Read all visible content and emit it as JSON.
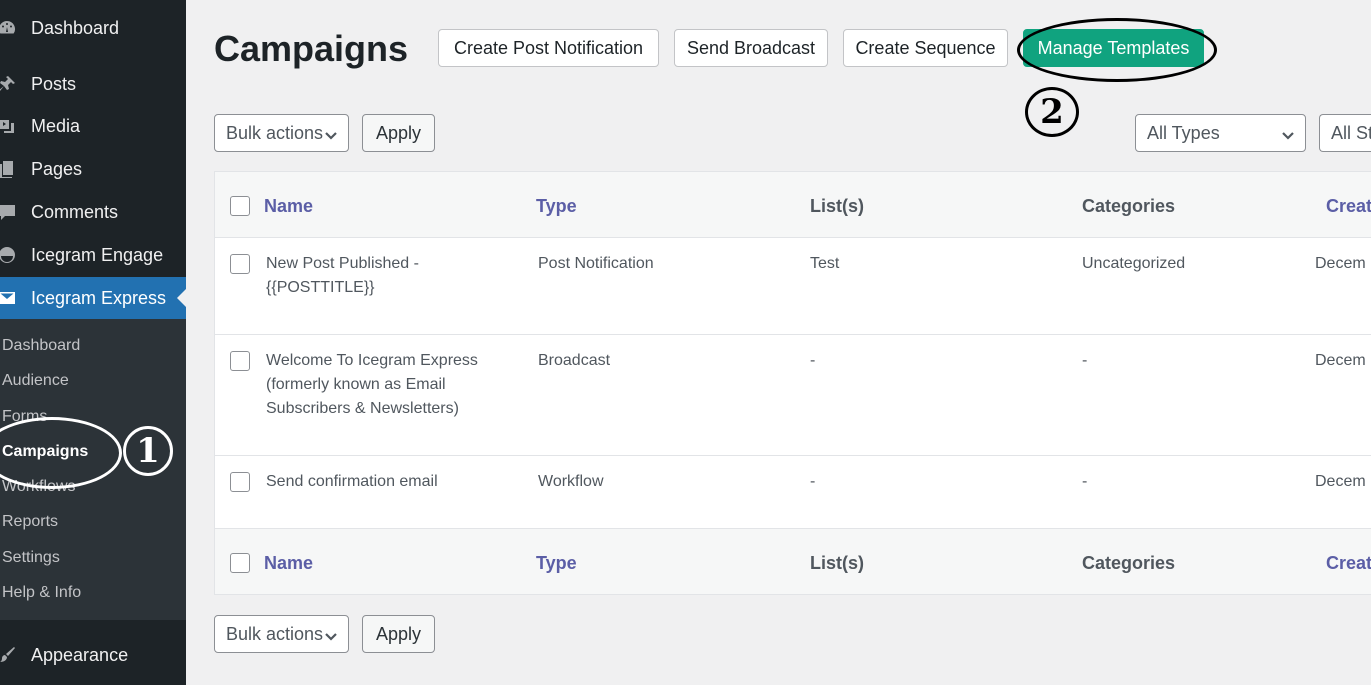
{
  "sidebar": {
    "top_items": [
      {
        "label": "Dashboard",
        "icon": "dashboard-icon"
      },
      {
        "label": "Posts",
        "icon": "pin-icon"
      },
      {
        "label": "Media",
        "icon": "media-icon"
      },
      {
        "label": "Pages",
        "icon": "pages-icon"
      },
      {
        "label": "Comments",
        "icon": "comment-icon"
      },
      {
        "label": "Icegram Engage",
        "icon": "smiley-icon"
      },
      {
        "label": "Icegram Express",
        "icon": "email-icon"
      }
    ],
    "submenu": [
      "Dashboard",
      "Audience",
      "Forms",
      "Campaigns",
      "Workflows",
      "Reports",
      "Settings",
      "Help & Info"
    ],
    "bottom_items": [
      {
        "label": "Appearance",
        "icon": "brush-icon"
      }
    ],
    "active_submenu": "Campaigns"
  },
  "annotations": {
    "one": "1",
    "two": "2"
  },
  "header": {
    "title": "Campaigns",
    "buttons": [
      "Create Post Notification",
      "Send Broadcast",
      "Create Sequence",
      "Manage Templates"
    ]
  },
  "controls": {
    "bulk_actions": "Bulk actions",
    "apply": "Apply",
    "type_filter": "All Types",
    "status_filter": "All Sta"
  },
  "table": {
    "columns": [
      "Name",
      "Type",
      "List(s)",
      "Categories",
      "Creat"
    ],
    "rows": [
      {
        "name": "New Post Published - {{POSTTITLE}}",
        "type": "Post Notification",
        "lists": "Test",
        "categories": "Uncategorized",
        "created": "Decem"
      },
      {
        "name": "Welcome To Icegram Express (formerly known as Email Subscribers & Newsletters)",
        "type": "Broadcast",
        "lists": "-",
        "categories": "-",
        "created": "Decem"
      },
      {
        "name": "Send confirmation email",
        "type": "Workflow",
        "lists": "-",
        "categories": "-",
        "created": "Decem"
      }
    ]
  },
  "colors": {
    "accent": "#2271b1",
    "green": "#10a37f",
    "sidebar": "#1d2327",
    "link": "#5b5ea6"
  }
}
